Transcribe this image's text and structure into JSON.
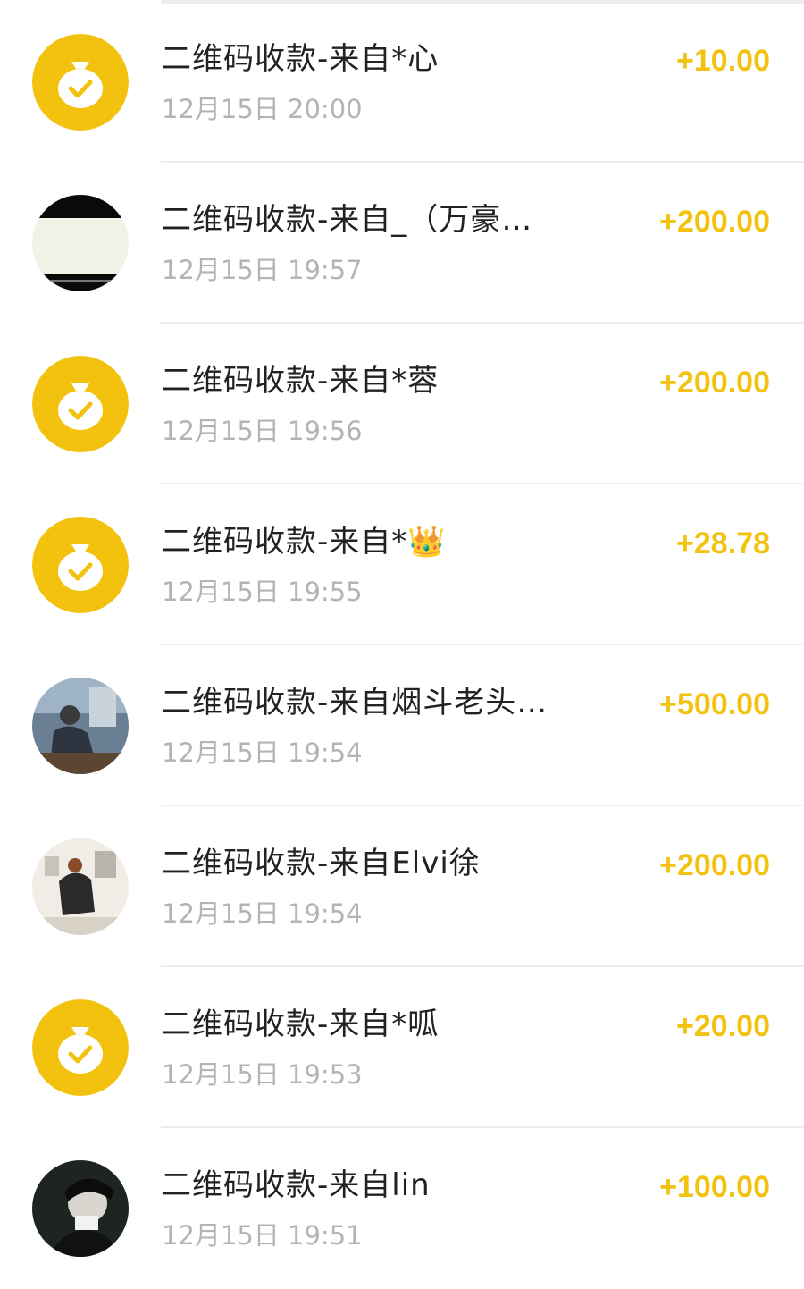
{
  "colors": {
    "accent": "#f2c20f",
    "title_text": "#222222",
    "time_text": "#b4b4b4",
    "divider": "#ededed"
  },
  "transactions": [
    {
      "avatar": "money-bag-icon",
      "title": "二维码收款-来自*心",
      "time": "12月15日 20:00",
      "amount": "+10.00"
    },
    {
      "avatar": "user-avatar-photo",
      "title": "二维码收款-来自_（万豪…",
      "time": "12月15日 19:57",
      "amount": "+200.00"
    },
    {
      "avatar": "money-bag-icon",
      "title": "二维码收款-来自*蓉",
      "time": "12月15日 19:56",
      "amount": "+200.00"
    },
    {
      "avatar": "money-bag-icon",
      "title": "二维码收款-来自*👑",
      "time": "12月15日 19:55",
      "amount": "+28.78"
    },
    {
      "avatar": "user-avatar-photo",
      "title": "二维码收款-来自烟斗老头…",
      "time": "12月15日 19:54",
      "amount": "+500.00"
    },
    {
      "avatar": "user-avatar-photo",
      "title": "二维码收款-来自Elvi徐",
      "time": "12月15日 19:54",
      "amount": "+200.00"
    },
    {
      "avatar": "money-bag-icon",
      "title": "二维码收款-来自*呱",
      "time": "12月15日 19:53",
      "amount": "+20.00"
    },
    {
      "avatar": "user-avatar-photo",
      "title": "二维码收款-来自lin",
      "time": "12月15日 19:51",
      "amount": "+100.00"
    }
  ]
}
